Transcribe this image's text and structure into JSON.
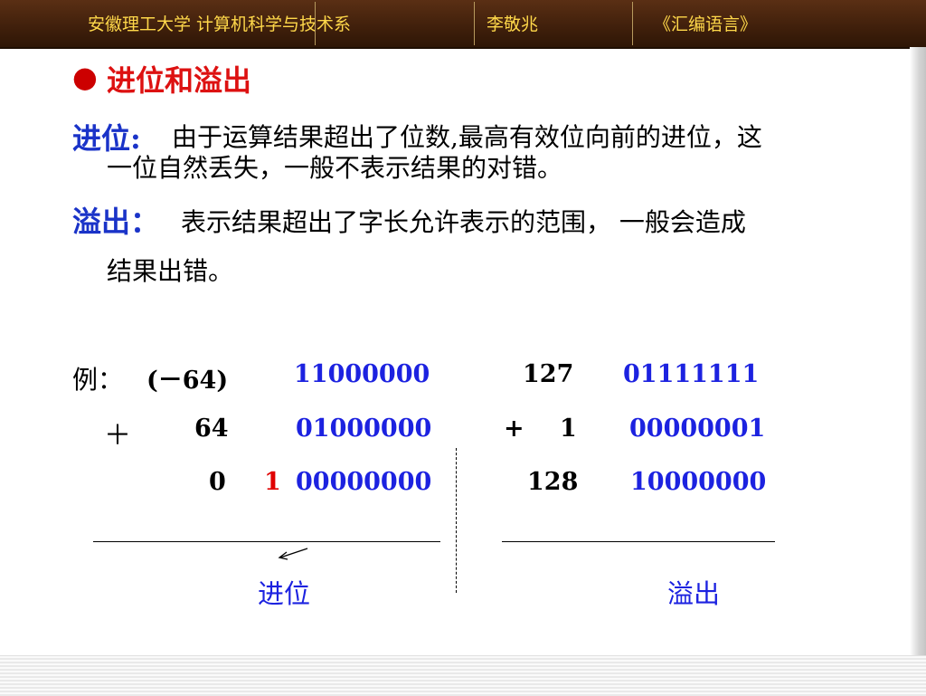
{
  "header": {
    "school": "安徽理工大学  计算机科学与技术系",
    "author": "李敬兆",
    "course": "《汇编语言》"
  },
  "slide": {
    "bullet_title": "进位和溢出",
    "carry_term": "进位:",
    "carry_line1": "由于运算结果超出了位数,最高有效位向前的进位，这",
    "carry_line2": "一位自然丢失，一般不表示结果的对错。",
    "overflow_term": "溢出：",
    "overflow_line1": "表示结果超出了字长允许表示的范围，  一般会造成",
    "overflow_line2": "结果出错。"
  },
  "example": {
    "label": "例：",
    "left": {
      "row1_dec": "(－64)",
      "row1_bin": "11000000",
      "row2_op": "＋",
      "row2_dec": "64",
      "row2_bin": "01000000",
      "row3_dec": "0",
      "row3_carry": "1",
      "row3_bin": "00000000",
      "caption": "进位"
    },
    "right": {
      "row1_dec": "127",
      "row1_bin": "01111111",
      "row2_op": "+",
      "row2_dec": "1",
      "row2_bin": "00000001",
      "row3_dec": "128",
      "row3_bin": "10000000",
      "caption": "溢出"
    }
  },
  "colors": {
    "header_text": "#ffd84a",
    "header_bg": "#3f1f0b",
    "title": "#dd1111",
    "term": "#1a33c8",
    "binary": "#1c22e0",
    "carry_bit": "#e00000"
  }
}
